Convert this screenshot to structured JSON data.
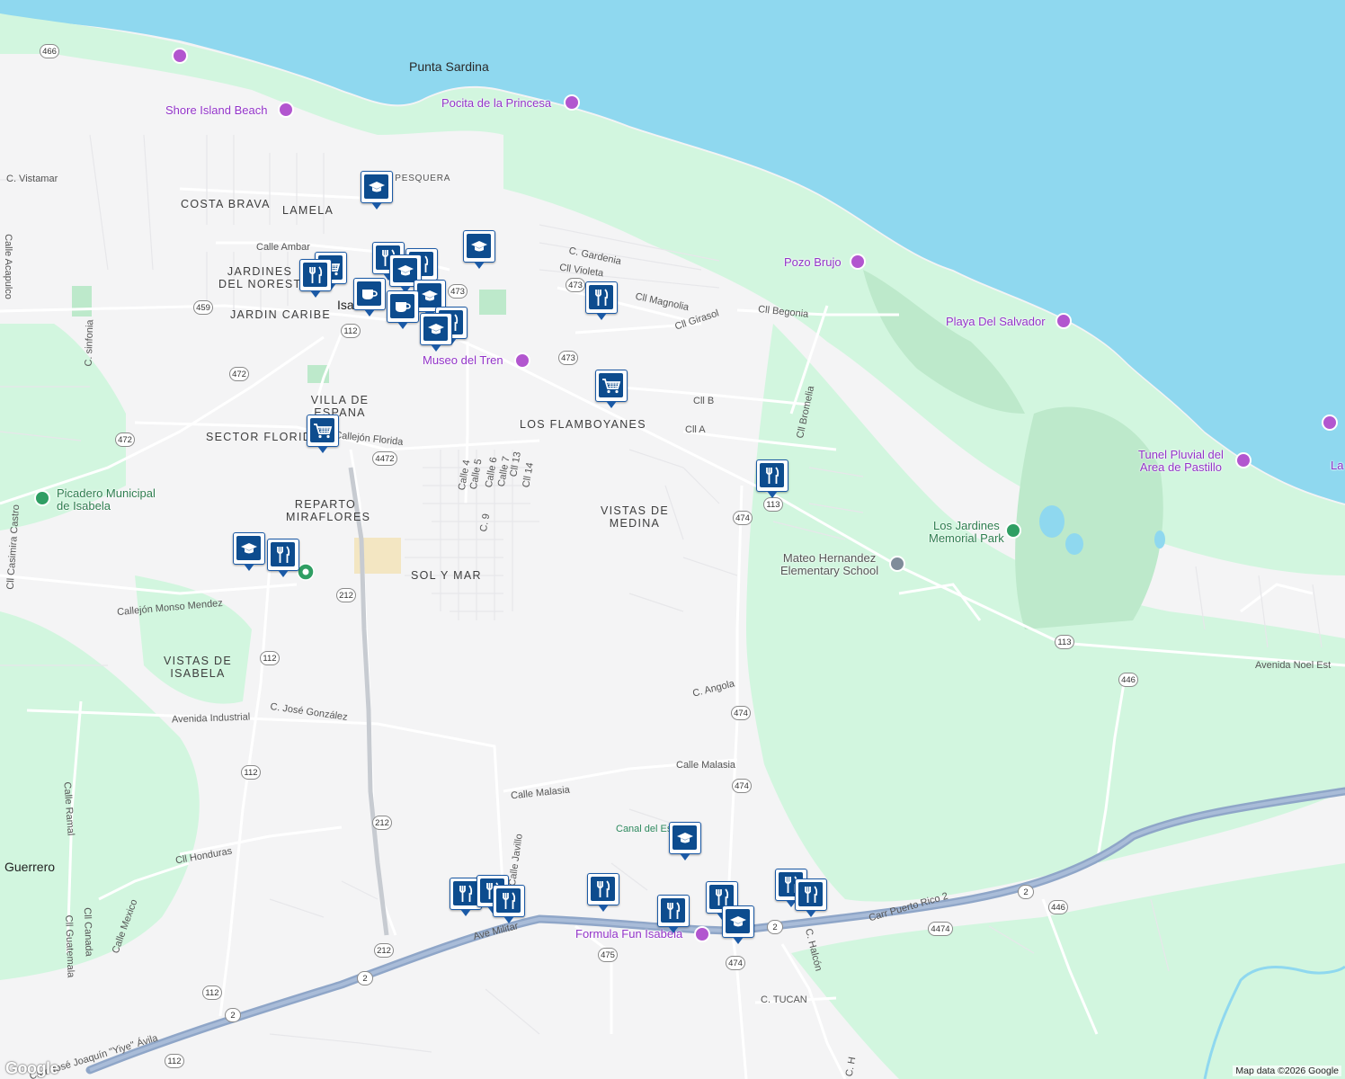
{
  "map": {
    "water_color": "#8fd8ef",
    "green_color": "#d2f6df",
    "land_color": "#f4f4f5",
    "highway_color": "#8fa6c8",
    "marker_color": "#0d4c8e"
  },
  "places": {
    "isabela": "Isa",
    "guerrero": "Guerrero",
    "punta_sardina": "Punta Sardina"
  },
  "areas": {
    "costa_brava": "COSTA BRAVA",
    "lamela": "LAMELA",
    "jardines_del_noreste_1": "JARDINES",
    "jardines_del_noreste_2": "DEL NORESTE",
    "jardin_caribe": "JARDIN CARIBE",
    "villa_de_espana_1": "VILLA DE",
    "villa_de_espana_2": "ESPANA",
    "sector_florida": "SECTOR FLORIDA",
    "los_flamboyanes": "LOS FLAMBOYANES",
    "vistas_de_medina_1": "VISTAS DE",
    "vistas_de_medina_2": "MEDINA",
    "reparto_miraflores_1": "REPARTO",
    "reparto_miraflores_2": "MIRAFLORES",
    "sol_y_mar": "SOL Y MAR",
    "vistas_de_isabela_1": "VISTAS DE",
    "vistas_de_isabela_2": "ISABELA"
  },
  "pois": {
    "shore_island_beach": "Shore Island Beach",
    "pocita_de_la_princesa": "Pocita de la Princesa",
    "pozo_brujo": "Pozo Brujo",
    "playa_del_salvador": "Playa Del Salvador",
    "tunel_pluvial_1": "Tunel Pluvial del",
    "tunel_pluvial_2": "Area de Pastillo",
    "la_partial": "La",
    "museo_del_tren": "Museo del Tren",
    "picadero_1": "Picadero Municipal",
    "picadero_2": "de Isabela",
    "los_jardines_1": "Los Jardines",
    "los_jardines_2": "Memorial Park",
    "mateo_1": "Mateo Hernandez",
    "mateo_2": "Elementary School",
    "formula_fun": "Formula Fun Isabela",
    "canal_del_este": "Canal del Este"
  },
  "streets": {
    "c_vistamar": "C. Vistamar",
    "calle_ambar": "Calle Ambar",
    "calle_acapulco": "Calle Acapulco",
    "c_sinfonia": "C. sinfonia",
    "c_gardenia": "C. Gardenia",
    "cll_violeta": "Cll Violeta",
    "cll_magnolia": "Cll Magnolia",
    "cll_girasol": "Cll Girasol",
    "cll_begonia": "Cll Begonia",
    "cll_b": "Cll B",
    "cll_a": "Cll A",
    "cll_bromelia": "Cll Bromelia",
    "callejon_florida": "Callejón Florida",
    "calle_4": "Calle 4",
    "calle_5": "Calle 5",
    "calle_6": "Calle 6",
    "calle_7": "Calle 7",
    "cll_13": "Cll 13",
    "cll_14": "Cll 14",
    "c_9": "C. 9",
    "cll_casimira_castro": "Cll Casimira Castro",
    "callejon_monso_mendez": "Callejón Monso Mendez",
    "avenida_industrial": "Avenida Industrial",
    "c_jose_gonzalez": "C. José González",
    "c_angola": "C. Angola",
    "calle_malasia_1": "Calle Malasia",
    "calle_malasia_2": "Calle Malasia",
    "calle_ramal": "Calle Ramal",
    "cll_honduras": "Cll Honduras",
    "calle_javillo": "Calle Javillo",
    "cll_canada": "Cll Canada",
    "calle_mexico": "Calle Mexico",
    "cll_guatemala": "Cll Guatemala",
    "ave_militar": "Ave Militar",
    "carr_pr_2": "Carr Puerto Rico 2",
    "avenida_noel": "Avenida Noel Est",
    "c_halcon": "C. Halcón",
    "c_tucan": "C. TUCAN",
    "jose_aviles": "Carr José Joaquín \"Yiye\" Ávila",
    "villa_pesquera": "VILLA PESQUERA",
    "c_h": "C. H"
  },
  "shields": [
    "466",
    "459",
    "112",
    "472",
    "472",
    "473",
    "473",
    "473",
    "4472",
    "212",
    "112",
    "112",
    "212",
    "212",
    "112",
    "112",
    "474",
    "474",
    "474",
    "474",
    "113",
    "113",
    "446",
    "446",
    "4474",
    "2",
    "2",
    "2",
    "2",
    "475"
  ],
  "markers": [
    {
      "type": "school-icon"
    },
    {
      "type": "school-icon"
    },
    {
      "type": "restaurant-icon"
    },
    {
      "type": "restaurant-icon"
    },
    {
      "type": "grocery-icon"
    },
    {
      "type": "restaurant-icon"
    },
    {
      "type": "school-icon"
    },
    {
      "type": "cafe-icon"
    },
    {
      "type": "school-icon"
    },
    {
      "type": "cafe-icon"
    },
    {
      "type": "restaurant-icon"
    },
    {
      "type": "school-icon"
    },
    {
      "type": "restaurant-icon"
    },
    {
      "type": "grocery-icon"
    },
    {
      "type": "grocery-icon"
    },
    {
      "type": "restaurant-icon"
    },
    {
      "type": "school-icon"
    },
    {
      "type": "restaurant-icon"
    },
    {
      "type": "restaurant-icon"
    },
    {
      "type": "restaurant-icon"
    },
    {
      "type": "restaurant-icon"
    },
    {
      "type": "restaurant-icon"
    },
    {
      "type": "school-icon"
    },
    {
      "type": "restaurant-icon"
    },
    {
      "type": "restaurant-icon"
    },
    {
      "type": "school-icon"
    },
    {
      "type": "restaurant-icon"
    },
    {
      "type": "restaurant-icon"
    }
  ],
  "footer": {
    "logo": "Google",
    "attribution": "Map data ©2026 Google"
  }
}
